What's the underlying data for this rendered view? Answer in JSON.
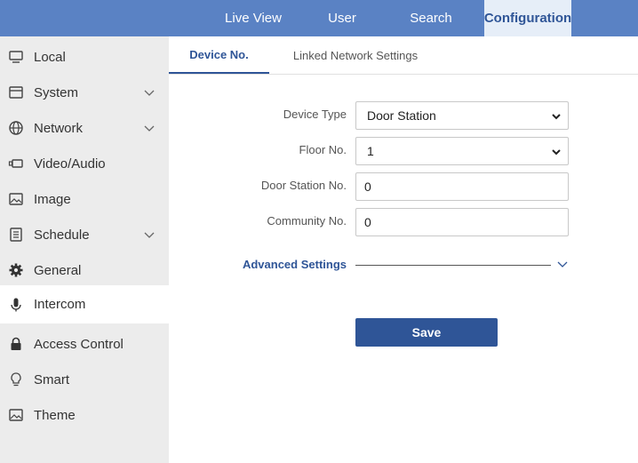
{
  "topnav": {
    "items": [
      {
        "label": "Live View"
      },
      {
        "label": "User"
      },
      {
        "label": "Search"
      },
      {
        "label": "Configuration"
      }
    ],
    "active": "Configuration"
  },
  "sidebar": {
    "items": [
      {
        "label": "Local",
        "icon": "monitor-icon",
        "expandable": false
      },
      {
        "label": "System",
        "icon": "system-icon",
        "expandable": true
      },
      {
        "label": "Network",
        "icon": "globe-icon",
        "expandable": true
      },
      {
        "label": "Video/Audio",
        "icon": "video-icon",
        "expandable": false
      },
      {
        "label": "Image",
        "icon": "image-icon",
        "expandable": false
      },
      {
        "label": "Schedule",
        "icon": "schedule-icon",
        "expandable": true
      },
      {
        "label": "General",
        "icon": "gear-icon",
        "expandable": false
      },
      {
        "label": "Intercom",
        "icon": "microphone-icon",
        "expandable": false
      },
      {
        "label": "Access Control",
        "icon": "lock-icon",
        "expandable": false
      },
      {
        "label": "Smart",
        "icon": "lightbulb-icon",
        "expandable": false
      },
      {
        "label": "Theme",
        "icon": "theme-icon",
        "expandable": false
      }
    ],
    "active": "Intercom"
  },
  "tabs": {
    "items": [
      {
        "label": "Device No."
      },
      {
        "label": "Linked Network Settings"
      }
    ],
    "active": "Device No."
  },
  "form": {
    "device_type": {
      "label": "Device Type",
      "value": "Door Station"
    },
    "floor_no": {
      "label": "Floor No.",
      "value": "1"
    },
    "door_station_no": {
      "label": "Door Station No.",
      "value": "0"
    },
    "community_no": {
      "label": "Community No.",
      "value": "0"
    },
    "advanced_label": "Advanced Settings",
    "save_label": "Save"
  },
  "colors": {
    "topbar": "#5a82c4",
    "accent": "#2f5597",
    "sidebar_bg": "#ececec",
    "active_nav_bg": "#e6eef8"
  }
}
